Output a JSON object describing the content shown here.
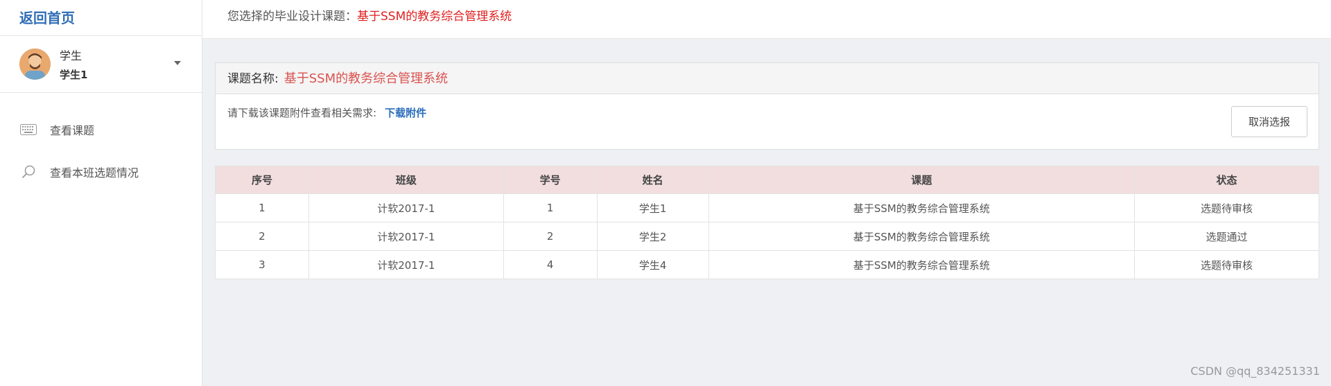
{
  "sidebar": {
    "home_label": "返回首页",
    "user": {
      "role": "学生",
      "name": "学生1"
    },
    "nav": [
      {
        "label": "查看课题",
        "icon": "keyboard-icon"
      },
      {
        "label": "查看本班选题情况",
        "icon": "search-icon"
      }
    ]
  },
  "topbar": {
    "prefix": "您选择的毕业设计课题：",
    "selected_title": "基于SSM的教务综合管理系统"
  },
  "panel": {
    "label": "课题名称:",
    "title": "基于SSM的教务综合管理系统",
    "hint": "请下载该课题附件查看相关需求:",
    "download_label": "下载附件",
    "cancel_label": "取消选报"
  },
  "table": {
    "headers": [
      "序号",
      "班级",
      "学号",
      "姓名",
      "课题",
      "状态"
    ],
    "rows": [
      [
        "1",
        "计软2017-1",
        "1",
        "学生1",
        "基于SSM的教务综合管理系统",
        "选题待审核"
      ],
      [
        "2",
        "计软2017-1",
        "2",
        "学生2",
        "基于SSM的教务综合管理系统",
        "选题通过"
      ],
      [
        "3",
        "计软2017-1",
        "4",
        "学生4",
        "基于SSM的教务综合管理系统",
        "选题待审核"
      ]
    ]
  },
  "watermark": "CSDN @qq_834251331",
  "colors": {
    "accent": "#2f6db5",
    "danger": "#e02020",
    "header_bg": "#f2dede"
  }
}
